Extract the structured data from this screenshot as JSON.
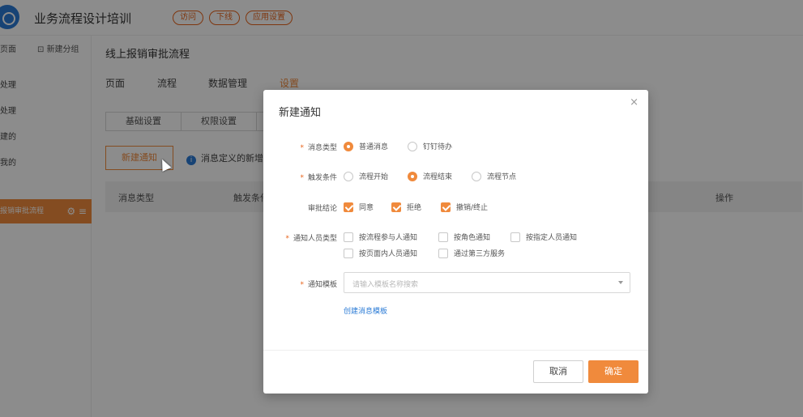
{
  "app": {
    "title": "业务流程设计培训",
    "pills": [
      "访问",
      "下线",
      "应用设置"
    ]
  },
  "sidebar": {
    "tabs": [
      "页面",
      "新建分组"
    ],
    "items": [
      "处理",
      "处理",
      "建的",
      "我的"
    ],
    "active_item": "报销审批流程"
  },
  "main": {
    "page_title": "线上报销审批流程",
    "tabs": [
      "页面",
      "流程",
      "数据管理",
      "设置"
    ],
    "active_tab": "设置",
    "segments": [
      "基础设置",
      "权限设置"
    ],
    "new_button": "新建通知",
    "info_text": "消息定义的新增",
    "table_headers": [
      "消息类型",
      "触发条件",
      "操作"
    ]
  },
  "modal": {
    "title": "新建通知",
    "close": "×",
    "message_type": {
      "label": "消息类型",
      "options": [
        "普通消息",
        "钉钉待办"
      ],
      "selected": "普通消息"
    },
    "trigger": {
      "label": "触发条件",
      "options": [
        "流程开始",
        "流程结束",
        "流程节点"
      ],
      "selected": "流程结束"
    },
    "approval_result": {
      "label": "审批结论",
      "options": [
        "同意",
        "拒绝",
        "撤销/终止"
      ],
      "checked": [
        true,
        true,
        true
      ]
    },
    "recipient_type": {
      "label": "通知人员类型",
      "options": [
        "按流程参与人通知",
        "按角色通知",
        "按指定人员通知",
        "按页面内人员通知",
        "通过第三方服务"
      ]
    },
    "template": {
      "label": "通知模板",
      "placeholder": "请输入模板名称搜索"
    },
    "create_template_link": "创建消息模板",
    "cancel_label": "取消",
    "confirm_label": "确定"
  },
  "colors": {
    "accent": "#f08a3c",
    "link": "#2b7bd6"
  }
}
